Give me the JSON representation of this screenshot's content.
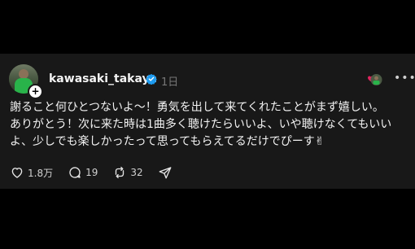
{
  "post": {
    "username": "kawasaki_takaya",
    "time": "1日",
    "text": "謝ること何ひとつないよ〜！勇気を出して来てくれたことがまず嬉しい。\nありがとう！次に来た時は1曲多く聴けたらいいよ、いや聴けなくてもいいよ、少しでも楽しかったって思ってもらえてるだけでぴーす✌",
    "more_label": "•••",
    "plus_label": "+"
  },
  "actions": {
    "like_count": "1.8万",
    "reply_count": "19",
    "repost_count": "32"
  },
  "colors": {
    "background": "#000000",
    "card": "#181818",
    "verified": "#1d9bf0",
    "muted": "#777777"
  },
  "icons": {
    "verified": "verified-badge-icon",
    "like": "heart-icon",
    "reply": "speech-bubble-icon",
    "repost": "repost-icon",
    "share": "send-icon",
    "more": "more-dots-icon"
  }
}
